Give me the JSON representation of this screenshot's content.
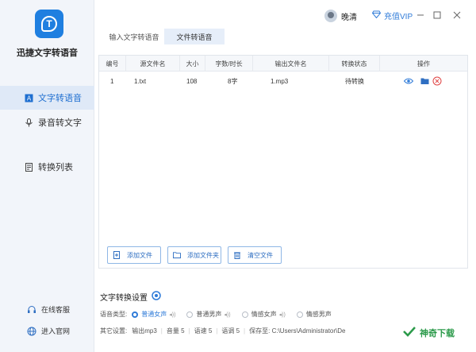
{
  "app": {
    "name": "迅捷文字转语音"
  },
  "sidebar": {
    "items": [
      {
        "label": "文字转语音",
        "icon": "text-to-speech-icon"
      },
      {
        "label": "录音转文字",
        "icon": "microphone-icon"
      },
      {
        "label": "转换列表",
        "icon": "list-document-icon"
      }
    ],
    "links": [
      {
        "label": "在线客服",
        "icon": "headset-icon"
      },
      {
        "label": "进入官网",
        "icon": "globe-icon"
      }
    ]
  },
  "header": {
    "username": "晚清",
    "vip_label": "充值VIP"
  },
  "tabs": [
    {
      "label": "输入文字转语音"
    },
    {
      "label": "文件转语音"
    }
  ],
  "table": {
    "columns": [
      "编号",
      "源文件名",
      "大小",
      "字数/时长",
      "输出文件名",
      "转换状态",
      "操作"
    ],
    "rows": [
      {
        "no": "1",
        "source": "1.txt",
        "size": "108",
        "count": "8字",
        "output": "1.mp3",
        "status": "待转换"
      }
    ]
  },
  "actions": {
    "add_file": "添加文件",
    "add_folder": "添加文件夹",
    "clear_files": "清空文件"
  },
  "settings": {
    "title": "文字转换设置",
    "voice_type_label": "语音类型:",
    "voices": [
      {
        "label": "普通女声",
        "selected": true
      },
      {
        "label": "普通男声",
        "selected": false
      },
      {
        "label": "情感女声",
        "selected": false
      },
      {
        "label": "情感男声",
        "selected": false
      }
    ],
    "other_label": "其它设置:",
    "output_format": "输出mp3",
    "volume": "音量 5",
    "speed": "语速 5",
    "pitch": "语调 5",
    "save_to": "保存至: C:\\Users\\Administrator\\De"
  },
  "watermark": {
    "text": "神奇下载"
  },
  "colors": {
    "accent": "#2f7bd8",
    "sidebar_bg": "#f2f5fa",
    "active_nav": "#dfe9f7",
    "danger": "#e04343"
  }
}
